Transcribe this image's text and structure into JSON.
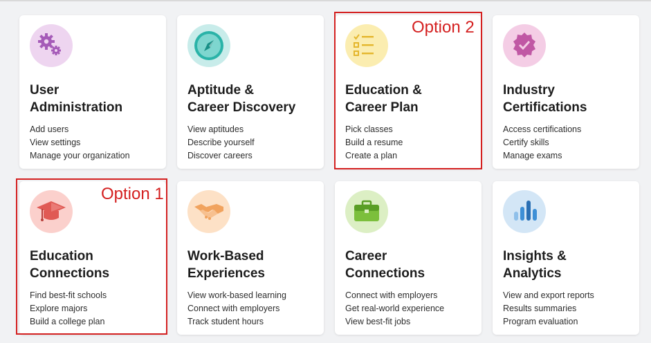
{
  "cards": [
    {
      "title_line1": "User",
      "title_line2": "Administration",
      "links": [
        "Add users",
        "View settings",
        "Manage your organization"
      ],
      "icon": "gears-icon",
      "icon_bg": "#eed5f0",
      "accent": "#a55bb8"
    },
    {
      "title_line1": "Aptitude &",
      "title_line2": "Career Discovery",
      "links": [
        "View aptitudes",
        "Describe yourself",
        "Discover careers"
      ],
      "icon": "compass-icon",
      "icon_bg": "#c8ecea",
      "accent": "#2ab3a8"
    },
    {
      "title_line1": "Education &",
      "title_line2": "Career Plan",
      "links": [
        "Pick classes",
        "Build a resume",
        "Create a plan"
      ],
      "icon": "checklist-icon",
      "icon_bg": "#fbedb0",
      "accent": "#e4b62c"
    },
    {
      "title_line1": "Industry",
      "title_line2": "Certifications",
      "links": [
        "Access certifications",
        "Certify skills",
        "Manage exams"
      ],
      "icon": "certified-badge-icon",
      "icon_bg": "#f4cde5",
      "accent": "#c058a4"
    },
    {
      "title_line1": "Education",
      "title_line2": "Connections",
      "links": [
        "Find best-fit schools",
        "Explore majors",
        "Build a college plan"
      ],
      "icon": "graduation-cap-icon",
      "icon_bg": "#fbd0cc",
      "accent": "#e05a54"
    },
    {
      "title_line1": "Work-Based",
      "title_line2": "Experiences",
      "links": [
        "View work-based learning",
        "Connect with employers",
        "Track student hours"
      ],
      "icon": "handshake-icon",
      "icon_bg": "#fde1c6",
      "accent": "#f1a35e"
    },
    {
      "title_line1": "Career",
      "title_line2": "Connections",
      "links": [
        "Connect with employers",
        "Get real-world experience",
        "View best-fit jobs"
      ],
      "icon": "briefcase-icon",
      "icon_bg": "#dcefc4",
      "accent": "#7cbf3c"
    },
    {
      "title_line1": "Insights &",
      "title_line2": "Analytics",
      "links": [
        "View and export reports",
        "Results summaries",
        "Program evaluation"
      ],
      "icon": "bar-chart-icon",
      "icon_bg": "#d3e6f6",
      "accent": "#3d8fd6"
    }
  ],
  "annotations": {
    "option1": "Option 1",
    "option2": "Option 2",
    "color": "#d42020"
  }
}
